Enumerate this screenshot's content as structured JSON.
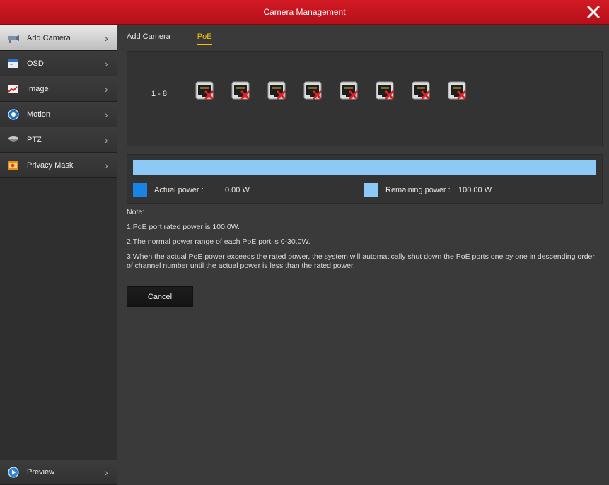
{
  "window": {
    "title": "Camera Management",
    "close_icon": "close-icon"
  },
  "sidebar": {
    "items": [
      {
        "label": "Add Camera",
        "icon": "camera-icon",
        "active": true
      },
      {
        "label": "OSD",
        "icon": "osd-icon"
      },
      {
        "label": "Image",
        "icon": "image-icon"
      },
      {
        "label": "Motion",
        "icon": "motion-icon"
      },
      {
        "label": "PTZ",
        "icon": "ptz-icon"
      },
      {
        "label": "Privacy Mask",
        "icon": "privacy-mask-icon"
      }
    ],
    "footer": {
      "label": "Preview",
      "icon": "preview-icon"
    }
  },
  "tabs": [
    {
      "label": "Add Camera"
    },
    {
      "label": "PoE",
      "active": true
    }
  ],
  "poe": {
    "range_label": "1 - 8",
    "ports": [
      "1",
      "2",
      "3",
      "4",
      "5",
      "6",
      "7",
      "8"
    ],
    "port_status": "disconnected"
  },
  "power": {
    "actual_label": "Actual power :",
    "actual_value": "0.00 W",
    "remaining_label": "Remaining power :",
    "remaining_value": "100.00 W",
    "actual_fraction": 0.0,
    "colors": {
      "actual": "#1a84e6",
      "remaining": "#8cc9f5"
    }
  },
  "notes": {
    "heading": "Note:",
    "lines": [
      "1.PoE port rated power is 100.0W.",
      "2.The normal power range of each PoE port is 0-30.0W.",
      "3.When the actual PoE power exceeds the rated power, the system will automatically shut down the PoE ports one by one in descending order of channel number until the actual power is less than the rated power."
    ]
  },
  "buttons": {
    "cancel": "Cancel"
  },
  "colors": {
    "title_bar": "#c8141e",
    "accent": "#f2c400"
  }
}
